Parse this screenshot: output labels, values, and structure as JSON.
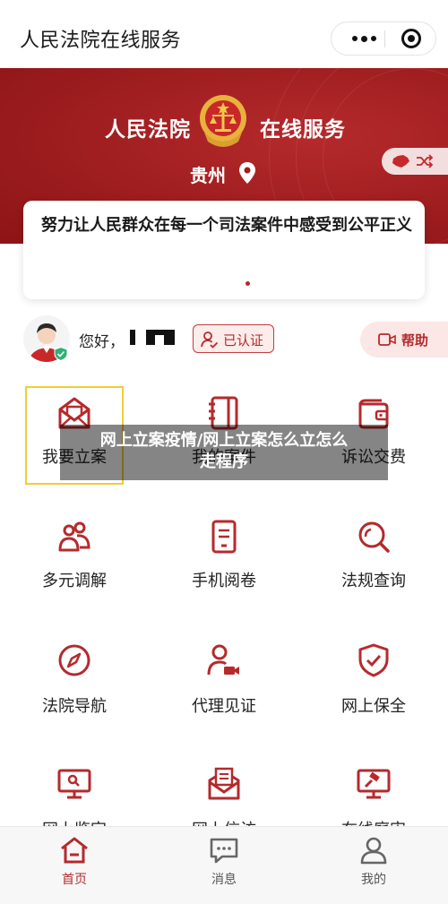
{
  "header": {
    "title": "人民法院在线服务"
  },
  "banner": {
    "left_text": "人民法院",
    "right_text": "在线服务",
    "location": "贵州",
    "slogan": "努力让人民群众在每一个司法案件中感受到公平正义"
  },
  "user": {
    "greeting": "您好，",
    "auth_status": "已认证",
    "help_label": "帮助"
  },
  "services": [
    {
      "label": "我要立案",
      "icon": "envelope-icon"
    },
    {
      "label": "我的案件",
      "icon": "notebook-icon"
    },
    {
      "label": "诉讼交费",
      "icon": "wallet-icon"
    },
    {
      "label": "多元调解",
      "icon": "people-icon"
    },
    {
      "label": "手机阅卷",
      "icon": "tablet-icon"
    },
    {
      "label": "法规查询",
      "icon": "search-icon"
    },
    {
      "label": "法院导航",
      "icon": "compass-icon"
    },
    {
      "label": "代理见证",
      "icon": "user-video-icon"
    },
    {
      "label": "网上保全",
      "icon": "shield-icon"
    },
    {
      "label": "网上鉴定",
      "icon": "monitor-icon"
    },
    {
      "label": "网上信访",
      "icon": "letter-icon"
    },
    {
      "label": "在线庭审",
      "icon": "gavel-screen-icon"
    }
  ],
  "overlay": {
    "line1": "网上立案疫情/网上立案怎么立怎么",
    "line2": "走程序"
  },
  "tabbar": [
    {
      "label": "首页",
      "icon": "home-icon",
      "active": true
    },
    {
      "label": "消息",
      "icon": "message-icon",
      "active": false
    },
    {
      "label": "我的",
      "icon": "profile-icon",
      "active": false
    }
  ],
  "colors": {
    "accent": "#b52a2c",
    "banner": "#9e1d1f",
    "highlight": "#f0cc3c"
  }
}
